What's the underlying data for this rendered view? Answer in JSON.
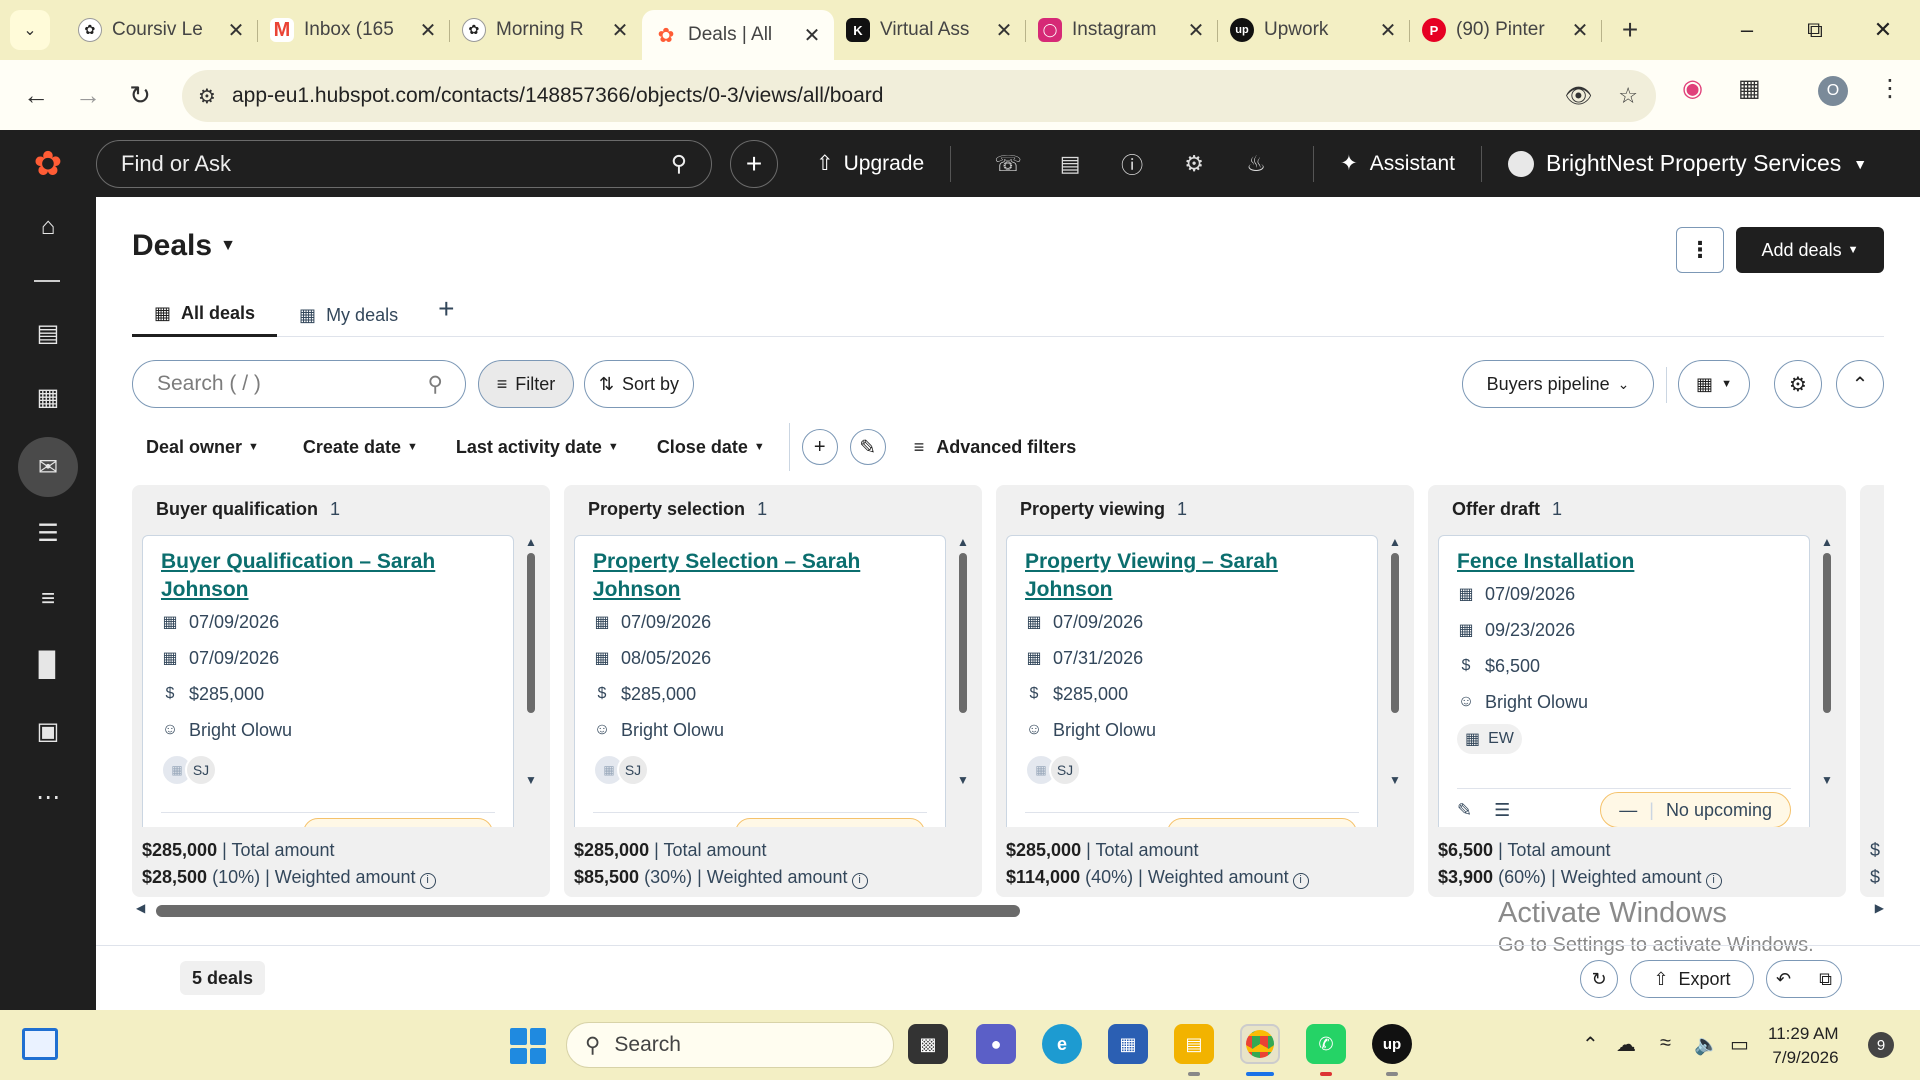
{
  "browser": {
    "tabs": [
      {
        "title": "Coursiv Le",
        "icon": "chatgpt-icon"
      },
      {
        "title": "Inbox (165",
        "icon": "gmail-icon"
      },
      {
        "title": "Morning R",
        "icon": "chatgpt-icon"
      },
      {
        "title": "Deals | All",
        "icon": "hubspot-icon"
      },
      {
        "title": "Virtual Ass",
        "icon": "k-icon"
      },
      {
        "title": "Instagram",
        "icon": "instagram-icon"
      },
      {
        "title": "Upwork",
        "icon": "upwork-icon"
      },
      {
        "title": "(90) Pinter",
        "icon": "pinterest-icon"
      }
    ],
    "url": "app-eu1.hubspot.com/contacts/148857366/objects/0-3/views/all/board",
    "profile_initial": "O"
  },
  "hubspot": {
    "search_placeholder": "Find or Ask",
    "upgrade_label": "Upgrade",
    "assistant_label": "Assistant",
    "account_name": "BrightNest Property Services",
    "brand_color": "#ff5c35"
  },
  "page": {
    "title": "Deals",
    "add_deals_label": "Add deals",
    "tabs": [
      {
        "label": "All deals",
        "active": true
      },
      {
        "label": "My deals",
        "active": false
      }
    ],
    "search_placeholder": "Search ( / )",
    "filter_label": "Filter",
    "sort_label": "Sort by",
    "pipeline_label": "Buyers pipeline",
    "filters": [
      "Deal owner",
      "Create date",
      "Last activity date",
      "Close date"
    ],
    "advanced_filters_label": "Advanced filters"
  },
  "board": {
    "columns": [
      {
        "name": "Buyer qualification",
        "count": "1",
        "card": {
          "title": "Buyer Qualification – Sarah Johnson",
          "create_date": "07/09/2026",
          "close_date": "07/09/2026",
          "amount": "$285,000",
          "owner": "Bright Olowu",
          "contact_initials": "SJ"
        },
        "total": "$285,000",
        "total_label": "| Total amount",
        "weighted": "$28,500",
        "weighted_pct": "(10%)",
        "weighted_label": "| Weighted amount"
      },
      {
        "name": "Property selection",
        "count": "1",
        "card": {
          "title": "Property Selection – Sarah Johnson",
          "create_date": "07/09/2026",
          "close_date": "08/05/2026",
          "amount": "$285,000",
          "owner": "Bright Olowu",
          "contact_initials": "SJ"
        },
        "total": "$285,000",
        "total_label": "| Total amount",
        "weighted": "$85,500",
        "weighted_pct": "(30%)",
        "weighted_label": "| Weighted amount"
      },
      {
        "name": "Property viewing",
        "count": "1",
        "card": {
          "title": "Property Viewing – Sarah Johnson",
          "create_date": "07/09/2026",
          "close_date": "07/31/2026",
          "amount": "$285,000",
          "owner": "Bright Olowu",
          "contact_initials": "SJ"
        },
        "total": "$285,000",
        "total_label": "| Total amount",
        "weighted": "$114,000",
        "weighted_pct": "(40%)",
        "weighted_label": "| Weighted amount"
      },
      {
        "name": "Offer draft",
        "count": "1",
        "card": {
          "title": "Fence Installation",
          "create_date": "07/09/2026",
          "close_date": "09/23/2026",
          "amount": "$6,500",
          "owner": "Bright Olowu",
          "company_initials": "EW",
          "activity_label": "No upcoming"
        },
        "total": "$6,500",
        "total_label": "| Total amount",
        "weighted": "$3,900",
        "weighted_pct": "(60%)",
        "weighted_label": "| Weighted amount"
      }
    ],
    "hidden_column_peek": "$"
  },
  "footer": {
    "deal_count": "5 deals",
    "export_label": "Export"
  },
  "watermark": {
    "line1": "Activate Windows",
    "line2": "Go to Settings to activate Windows."
  },
  "taskbar": {
    "search_label": "Search",
    "time": "11:29 AM",
    "date": "7/9/2026",
    "notification_count": "9"
  }
}
